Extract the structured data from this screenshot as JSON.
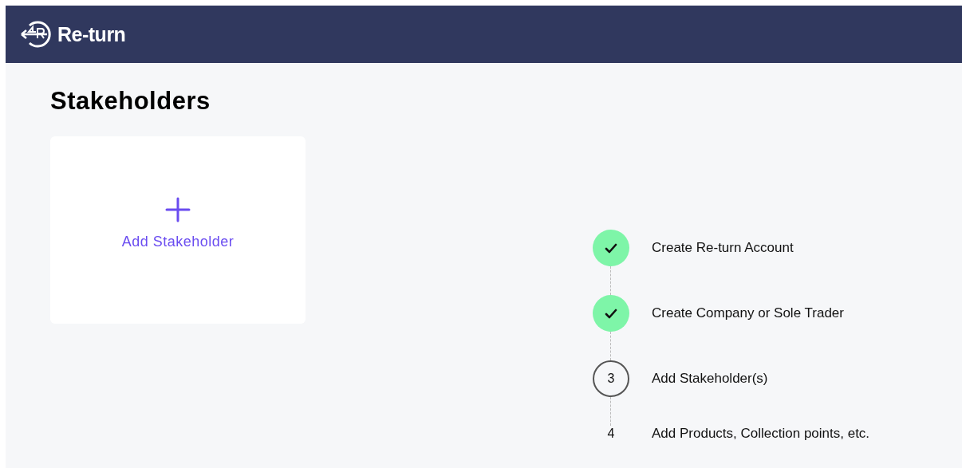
{
  "header": {
    "brand": "Re-turn"
  },
  "page": {
    "title": "Stakeholders"
  },
  "add_card": {
    "label": "Add Stakeholder"
  },
  "steps": [
    {
      "kind": "done",
      "label": "Create Re-turn Account"
    },
    {
      "kind": "done",
      "label": "Create Company or Sole Trader"
    },
    {
      "kind": "current",
      "number": "3",
      "label": "Add Stakeholder(s)"
    },
    {
      "kind": "upcoming",
      "number": "4",
      "label": "Add Products, Collection points, etc."
    }
  ]
}
